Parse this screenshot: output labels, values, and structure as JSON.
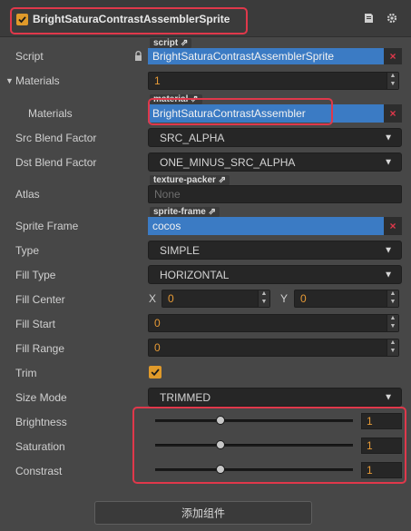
{
  "header": {
    "title": "BrightSaturaContrastAssemblerSprite",
    "enabled": true,
    "book_icon": "book-icon",
    "gear_icon": "gear-icon"
  },
  "script": {
    "label": "Script",
    "tag": "script",
    "value": "BrightSaturaContrastAssemblerSprite",
    "lock_icon": "lock-icon"
  },
  "materials_group": {
    "label": "Materials",
    "count": "1"
  },
  "materials_item": {
    "label": "Materials",
    "tag": "material",
    "value": "BrightSaturaContrastAssembler"
  },
  "src_blend": {
    "label": "Src Blend Factor",
    "value": "SRC_ALPHA"
  },
  "dst_blend": {
    "label": "Dst Blend Factor",
    "value": "ONE_MINUS_SRC_ALPHA"
  },
  "atlas": {
    "label": "Atlas",
    "tag": "texture-packer",
    "value": "None"
  },
  "sprite_frame": {
    "label": "Sprite Frame",
    "tag": "sprite-frame",
    "value": "cocos"
  },
  "type": {
    "label": "Type",
    "value": "SIMPLE"
  },
  "fill_type": {
    "label": "Fill Type",
    "value": "HORIZONTAL"
  },
  "fill_center": {
    "label": "Fill Center",
    "x_label": "X",
    "x_value": "0",
    "y_label": "Y",
    "y_value": "0"
  },
  "fill_start": {
    "label": "Fill Start",
    "value": "0"
  },
  "fill_range": {
    "label": "Fill Range",
    "value": "0"
  },
  "trim": {
    "label": "Trim",
    "checked": true
  },
  "size_mode": {
    "label": "Size Mode",
    "value": "TRIMMED"
  },
  "brightness": {
    "label": "Brightness",
    "value": "1",
    "slider_fraction": 0.33
  },
  "saturation": {
    "label": "Saturation",
    "value": "1",
    "slider_fraction": 0.33
  },
  "contrast": {
    "label": "Constrast",
    "value": "1",
    "slider_fraction": 0.33
  },
  "add_component": {
    "label": "添加组件"
  },
  "colors": {
    "accent": "#e69a36",
    "asset_blue": "#3b7bc4",
    "highlight_red": "#e0384b",
    "background": "#474747"
  }
}
